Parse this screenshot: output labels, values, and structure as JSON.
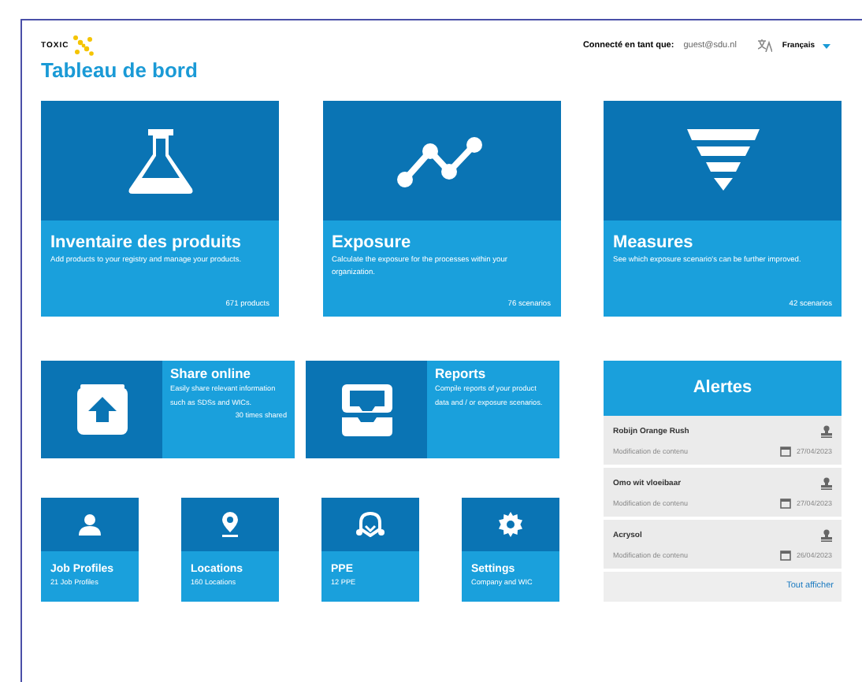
{
  "header": {
    "logo": "TOXIC",
    "user_label": "Connecté en tant que:",
    "user": "guest@sdu.nl",
    "language": "Français"
  },
  "title": "Tableau de bord",
  "cards": [
    {
      "kind": "flask",
      "title": "Inventaire des produits",
      "description": "Add products to your registry and manage your products.",
      "count": "671 products"
    },
    {
      "kind": "chart",
      "title": "Exposure",
      "description": "Calculate the exposure for the processes within your organization.",
      "count": "76 scenarios"
    },
    {
      "kind": "funnel",
      "title": "Measures",
      "description": "See which exposure scenario's can be further improved.",
      "count": "42 scenarios"
    }
  ],
  "wide_cards": [
    {
      "kind": "upload",
      "title": "Share online",
      "description": "Easily share relevant information such as SDSs and WICs.",
      "count": "30 times shared"
    },
    {
      "kind": "inbox",
      "title": "Reports",
      "description": "Compile reports of your product data and / or exposure scenarios."
    }
  ],
  "tiles": [
    {
      "kind": "person",
      "title": "Job Profiles",
      "subtitle": "21 Job Profiles"
    },
    {
      "kind": "pin",
      "title": "Locations",
      "subtitle": "160 Locations"
    },
    {
      "kind": "mask",
      "title": "PPE",
      "subtitle": "12 PPE"
    },
    {
      "kind": "gear",
      "title": "Settings",
      "subtitle": "Company and WIC"
    }
  ],
  "alerts": {
    "title": "Alertes",
    "items": [
      {
        "name": "Robijn Orange Rush",
        "type": "Modification de contenu",
        "date": "27/04/2023"
      },
      {
        "name": "Omo wit vloeibaar",
        "type": "Modification de contenu",
        "date": "27/04/2023"
      },
      {
        "name": "Acrysol",
        "type": "Modification de contenu",
        "date": "26/04/2023"
      }
    ],
    "link": "Tout afficher"
  }
}
